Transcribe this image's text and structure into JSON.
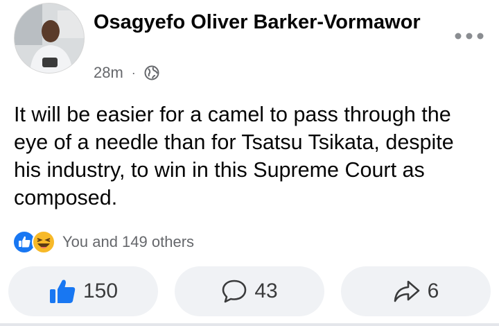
{
  "post": {
    "author": "Osagyefo Oliver Barker-Vormawor",
    "time": "28m",
    "privacy_icon": "globe-icon",
    "more_icon": "more-options-icon",
    "text": "It will be easier for a camel to pass through the eye of a needle than for Tsatsu Tsikata, despite his industry, to win in this Supreme Court as composed."
  },
  "reactions": {
    "icons": [
      "like-reaction-icon",
      "haha-reaction-icon"
    ],
    "summary": "You and 149 others"
  },
  "actions": {
    "like_count": "150",
    "comment_count": "43",
    "share_count": "6"
  },
  "colors": {
    "like_blue": "#1877f2",
    "button_bg": "#f0f2f5",
    "secondary_text": "#65676b",
    "haha_yellow": "#f7b928"
  }
}
